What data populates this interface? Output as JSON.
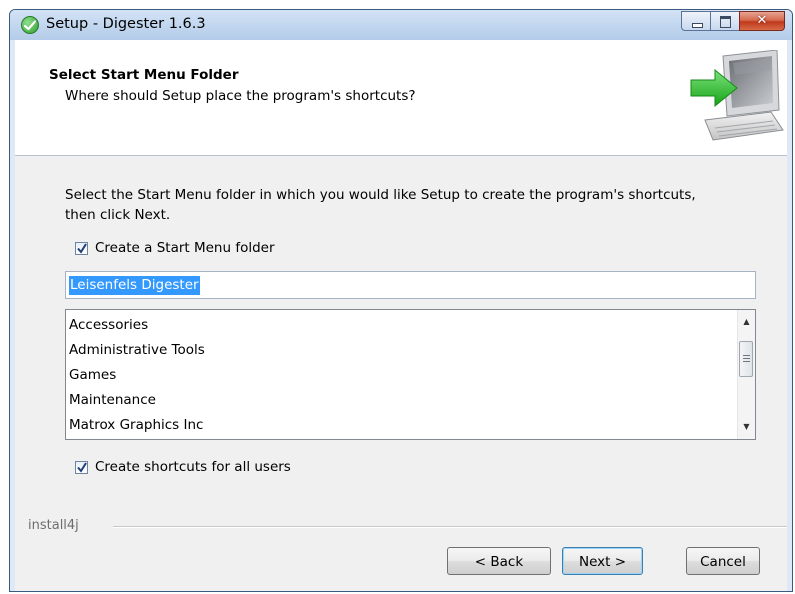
{
  "window": {
    "title": "Setup - Digester 1.6.3",
    "close_glyph": "✕"
  },
  "header": {
    "title": "Select Start Menu Folder",
    "subtitle": "Where should Setup place the program's shortcuts?"
  },
  "content": {
    "description": "Select the Start Menu folder in which you would like Setup to create the program's shortcuts, then click Next.",
    "create_folder_checkbox": {
      "label": "Create a Start Menu folder",
      "checked": true
    },
    "folder_name": "Leisenfels Digester",
    "folder_list": [
      "Accessories",
      "Administrative Tools",
      "Games",
      "Maintenance",
      "Matrox Graphics Inc"
    ],
    "all_users_checkbox": {
      "label": "Create shortcuts for all users",
      "checked": true
    }
  },
  "footer": {
    "brand": "install4j",
    "back_label": "< Back",
    "next_label": "Next >",
    "cancel_label": "Cancel"
  },
  "icons": {
    "title": "setup-check-icon",
    "header": "computer-install-arrow-icon"
  },
  "colors": {
    "selection": "#3399ff",
    "arrow_green": "#2fb82f"
  }
}
